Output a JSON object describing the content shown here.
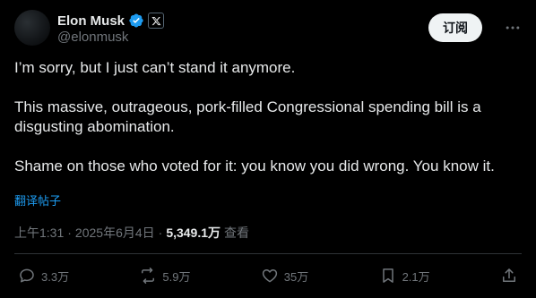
{
  "author": {
    "display_name": "Elon Musk",
    "handle": "@elonmusk",
    "verified_icon": "verified-badge-icon",
    "affiliation_icon": "x-logo-icon"
  },
  "header": {
    "subscribe_label": "订阅",
    "more_icon": "more-icon"
  },
  "post": {
    "paragraphs": [
      "I’m sorry, but I just can’t stand it anymore.",
      "This massive, outrageous, pork-filled Congressional spending bill is a disgusting abomination.",
      "Shame on those who voted for it: you know you did wrong. You know it."
    ],
    "translate_label": "翻译帖子"
  },
  "meta": {
    "time": "上午1:31",
    "separator1": "·",
    "date": "2025年6月4日",
    "separator2": "·",
    "views_count": "5,349.1万",
    "views_label": "查看"
  },
  "actions": {
    "replies": "3.3万",
    "reposts": "5.9万",
    "likes": "35万",
    "bookmarks": "2.1万"
  },
  "colors": {
    "background": "#000000",
    "text": "#e7e9ea",
    "secondary": "#71767b",
    "accent": "#1d9bf0",
    "button_bg": "#eff3f4"
  }
}
